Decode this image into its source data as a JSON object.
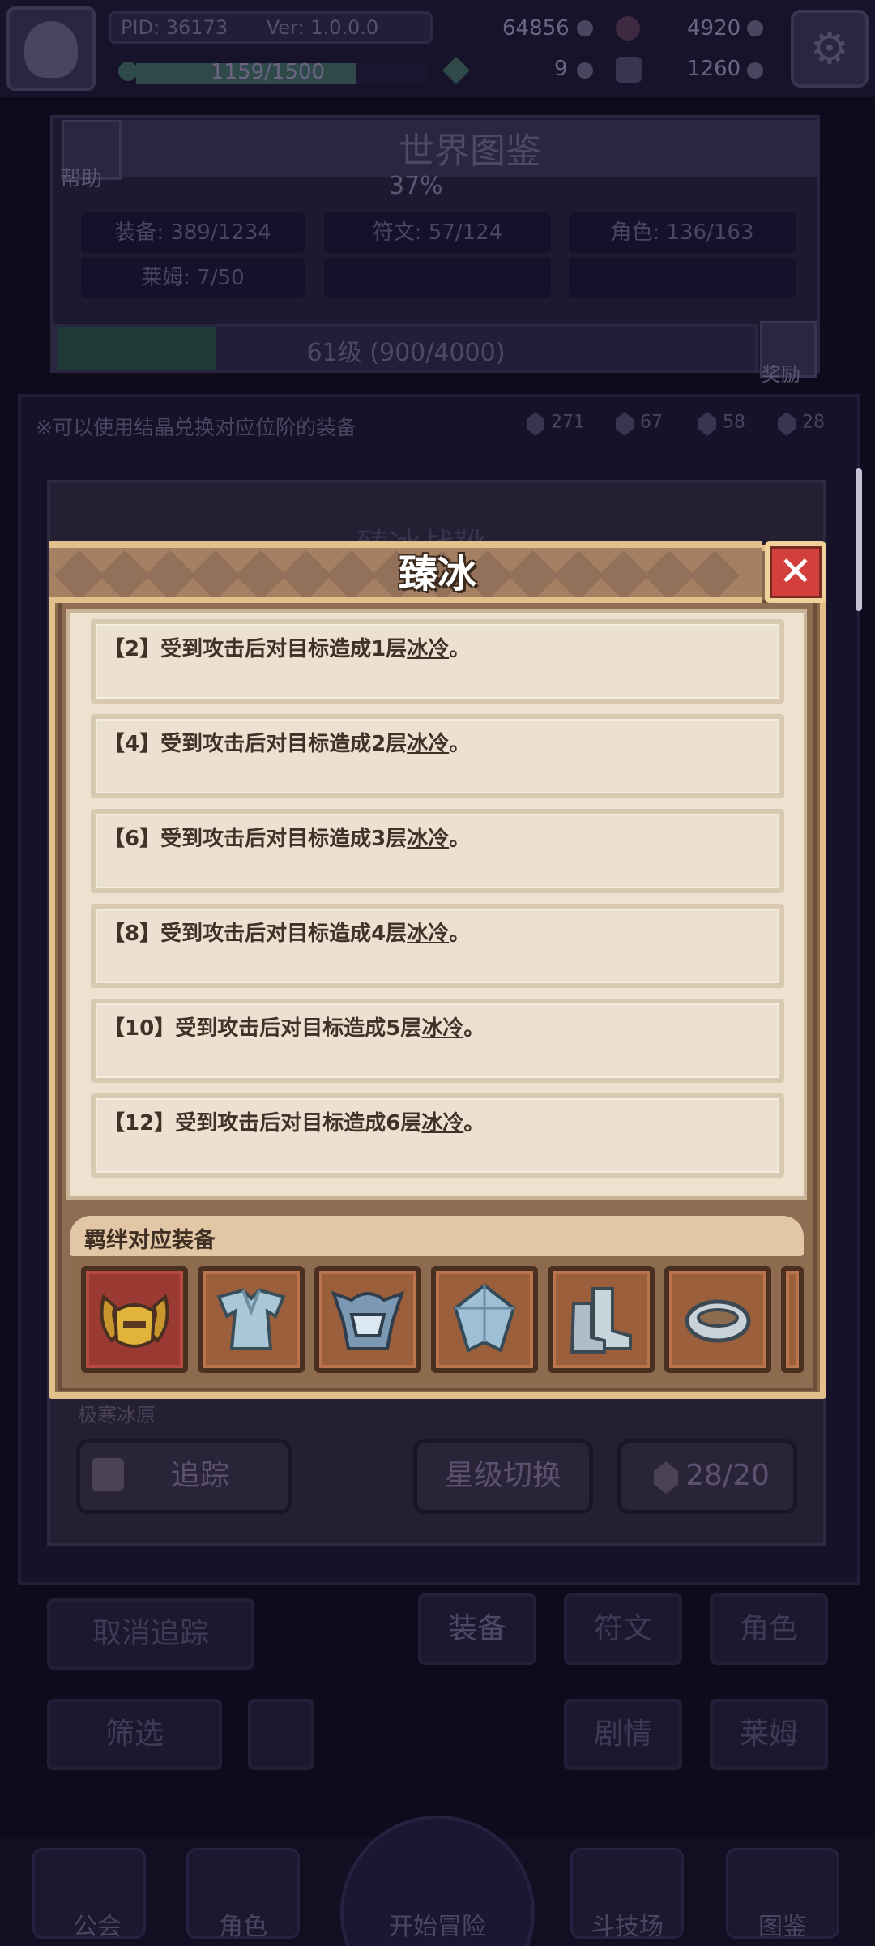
{
  "hud": {
    "pid": "PID: 36173",
    "version": "Ver: 1.0.0.0",
    "exp": "1159/1500",
    "gold": "64856",
    "gems": "4920",
    "resource_a": "9",
    "resource_b": "1260",
    "exp_progress": 0.773
  },
  "codex": {
    "title": "世界图鉴",
    "help": "帮助",
    "percent": "37%",
    "stats": [
      "装备: 389/1234",
      "符文: 57/124",
      "角色: 136/163",
      "莱姆: 7/50"
    ],
    "level": "61级 (900/4000)",
    "level_progress": 0.225,
    "reward": "奖励"
  },
  "list": {
    "hint": "※可以使用结晶兑换对应位阶的装备",
    "crystals": [
      "271",
      "67",
      "58",
      "28"
    ]
  },
  "detail": {
    "partial_title": "臻冰战靴",
    "partial_caption": "极寒冰原",
    "track": "追踪",
    "star_switch": "星级切换",
    "count": "28/20"
  },
  "filters": {
    "untrack": "取消追踪",
    "equip": "装备",
    "rune": "符文",
    "role": "角色",
    "filter": "筛选",
    "stage": "剧情",
    "lime": "莱姆"
  },
  "nav": [
    "公会",
    "角色",
    "开始冒险",
    "斗技场",
    "图鉴"
  ],
  "modal": {
    "title": "臻冰",
    "close_icon": "close-x",
    "bonuses": [
      {
        "tier": "【2】",
        "text": "受到攻击后对目标造成1层",
        "keyword": "冰冷",
        "end": "。"
      },
      {
        "tier": "【4】",
        "text": "受到攻击后对目标造成2层",
        "keyword": "冰冷",
        "end": "。"
      },
      {
        "tier": "【6】",
        "text": "受到攻击后对目标造成3层",
        "keyword": "冰冷",
        "end": "。"
      },
      {
        "tier": "【8】",
        "text": "受到攻击后对目标造成4层",
        "keyword": "冰冷",
        "end": "。"
      },
      {
        "tier": "【10】",
        "text": "受到攻击后对目标造成5层",
        "keyword": "冰冷",
        "end": "。"
      },
      {
        "tier": "【12】",
        "text": "受到攻击后对目标造成6层",
        "keyword": "冰冷",
        "end": "。"
      }
    ],
    "equip_section_label": "羁绊对应装备",
    "equipment": [
      "golden-helmet-icon",
      "ice-armor-icon",
      "ice-helmet-icon",
      "ice-crystal-shield-icon",
      "ice-boots-icon",
      "ice-ring-icon"
    ]
  },
  "colors": {
    "modal_frame": "#e3c08b",
    "parchment": "#ede1cf",
    "close_red": "#d23f3c"
  }
}
